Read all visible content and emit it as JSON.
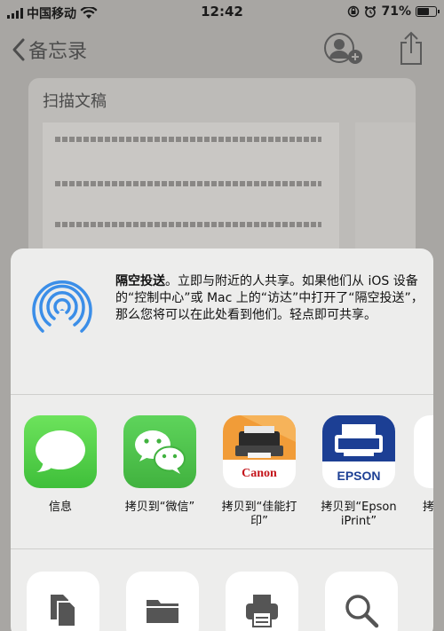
{
  "status": {
    "carrier": "中国移动",
    "time": "12:42",
    "battery_percent": "71%",
    "battery_level": 0.71
  },
  "nav": {
    "back_label": "备忘录"
  },
  "note": {
    "title": "扫描文稿"
  },
  "airdrop": {
    "title": "隔空投送",
    "description": "。立即与附近的人共享。如果他们从 iOS 设备的“控制中心”或 Mac 上的“访达”中打开了“隔空投送”，那么您将可以在此处看到他们。轻点即可共享。"
  },
  "apps": [
    {
      "label": "信息",
      "icon": "messages-icon"
    },
    {
      "label": "拷贝到“微信”",
      "icon": "wechat-icon"
    },
    {
      "label": "拷贝到“佳能打印”",
      "icon": "canon-print-icon",
      "brand": "Canon"
    },
    {
      "label": "拷贝到“Epson iPrint”",
      "icon": "epson-iprint-icon",
      "brand": "EPSON"
    },
    {
      "label": "拷",
      "icon": "more-app-icon"
    }
  ],
  "actions": [
    {
      "icon": "copy-icon"
    },
    {
      "icon": "save-to-files-icon"
    },
    {
      "icon": "print-icon"
    },
    {
      "icon": "find-icon"
    }
  ],
  "colors": {
    "airdrop_blue": "#3b8ee8",
    "canon_red": "#c4161c",
    "epson_blue": "#1c3f94"
  }
}
